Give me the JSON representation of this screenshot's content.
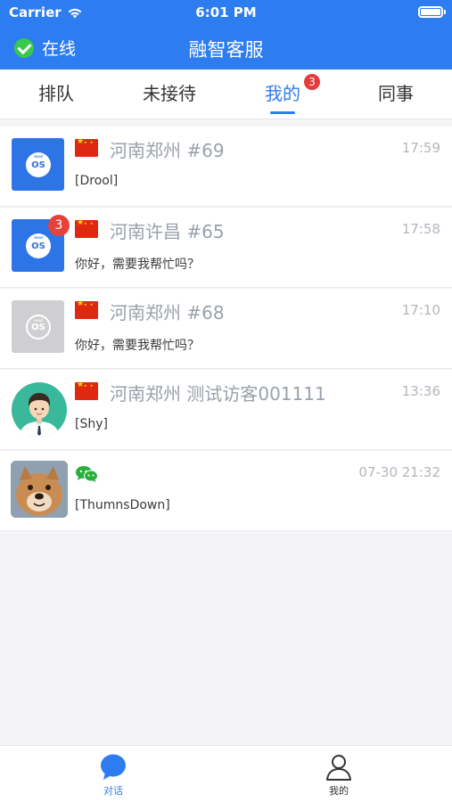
{
  "status_bar": {
    "carrier": "Carrier",
    "time": "6:01 PM"
  },
  "header": {
    "status_label": "在线",
    "title": "融智客服"
  },
  "tabs": [
    {
      "label": "排队",
      "active": false
    },
    {
      "label": "未接待",
      "active": false
    },
    {
      "label": "我的",
      "active": true,
      "badge": "3"
    },
    {
      "label": "同事",
      "active": false
    }
  ],
  "conversations": [
    {
      "title": "河南郑州 #69",
      "time": "17:59",
      "message": "[Drool]",
      "avatar": "os-blue",
      "badge": ""
    },
    {
      "title": "河南许昌 #65",
      "time": "17:58",
      "message": "你好，需要我帮忙吗？",
      "avatar": "os-blue",
      "badge": "3"
    },
    {
      "title": "河南郑州 #68",
      "time": "17:10",
      "message": "你好，需要我帮忙吗？",
      "avatar": "os-gray",
      "badge": ""
    },
    {
      "title": "河南郑州 测试访客001111",
      "time": "13:36",
      "message": "[Shy]",
      "avatar": "person",
      "badge": ""
    },
    {
      "title": "",
      "time": "07-30 21:32",
      "message": "[ThumnsDown]",
      "avatar": "dog",
      "badge": ""
    }
  ],
  "avatar_text": "OS",
  "bottom_nav": [
    {
      "label": "对话",
      "icon": "chat-bubble-icon",
      "active": true
    },
    {
      "label": "我的",
      "icon": "person-icon",
      "active": false
    }
  ],
  "colors": {
    "primary": "#2d7cf0",
    "badge": "#e63b3b",
    "online": "#38c84c"
  }
}
